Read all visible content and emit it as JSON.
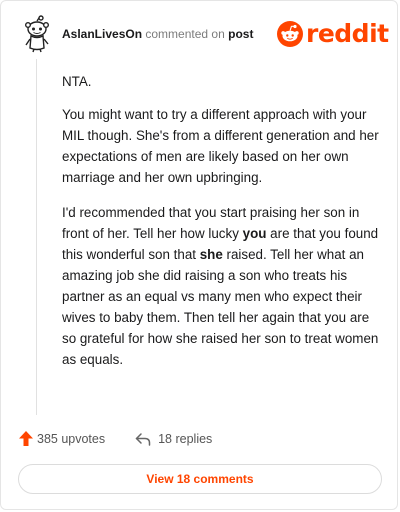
{
  "header": {
    "username": "AslanLivesOn",
    "action_text": "commented on",
    "target_text": "post",
    "logo_text": "reddit"
  },
  "comment": {
    "paragraph1": "NTA.",
    "paragraph2": "You might want to try a different approach with your MIL though. She's from a different generation and her expectations of men are likely based on her own marriage and her own upbringing.",
    "paragraph3_part1": "I'd recommended that you start praising her son in front of her. Tell her how lucky ",
    "paragraph3_bold1": "you",
    "paragraph3_part2": " are that you found this wonderful son that ",
    "paragraph3_bold2": "she",
    "paragraph3_part3": " raised. Tell her what an amazing job she did raising a son who treats his partner as an equal vs many men who expect their wives to baby them. Then tell her again that you are so grateful for how she raised her son to treat women as equals."
  },
  "actions": {
    "upvotes_label": "385 upvotes",
    "replies_label": "18 replies",
    "view_comments_label": "View 18 comments"
  },
  "colors": {
    "brand": "#ff4500",
    "text": "#1a1a1b",
    "muted": "#7c7c7c"
  },
  "icons": {
    "avatar": "snoo-avatar-icon",
    "logo": "reddit-snoo-logo-icon",
    "upvote": "upvote-arrow-icon",
    "reply": "reply-arrow-icon"
  }
}
